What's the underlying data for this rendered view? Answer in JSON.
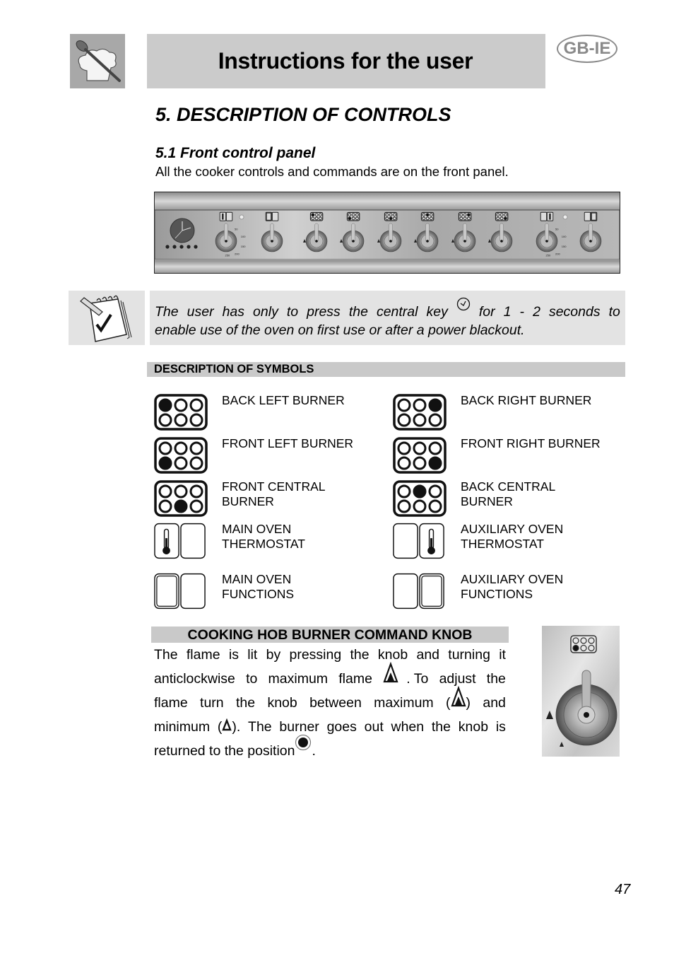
{
  "header": {
    "title": "Instructions for the user",
    "language_badge": "GB-IE",
    "logo_icon": "chef-hat-spoon-icon"
  },
  "section": {
    "title": "5.  DESCRIPTION OF CONTROLS",
    "subsection_title": "5.1 Front control panel",
    "intro": "All the cooker controls and commands are on the front panel."
  },
  "control_panel": {
    "image": "front-control-panel-illustration",
    "clock": "analog-clock-programmer",
    "clock_buttons": 5,
    "knobs": [
      {
        "name": "main-oven-thermostat-knob",
        "symbol": "main-oven-thermostat",
        "scale": [
          "50",
          "100",
          "150",
          "200",
          "250"
        ]
      },
      {
        "name": "main-oven-functions-knob",
        "symbol": "main-oven-functions"
      },
      {
        "name": "back-left-burner-knob",
        "symbol": "burner-back-left"
      },
      {
        "name": "front-left-burner-knob",
        "symbol": "burner-front-left"
      },
      {
        "name": "front-central-burner-knob",
        "symbol": "burner-front-central"
      },
      {
        "name": "back-central-burner-knob",
        "symbol": "burner-back-central"
      },
      {
        "name": "back-right-burner-knob",
        "symbol": "burner-back-right"
      },
      {
        "name": "front-right-burner-knob",
        "symbol": "burner-front-right"
      },
      {
        "name": "auxiliary-oven-thermostat-knob",
        "symbol": "aux-oven-thermostat",
        "scale": [
          "50",
          "100",
          "150",
          "200",
          "250"
        ]
      },
      {
        "name": "auxiliary-oven-functions-knob",
        "symbol": "aux-oven-functions"
      }
    ]
  },
  "note": {
    "icon": "notepad-check-icon",
    "line1_words": [
      "The",
      "user",
      "has",
      "only",
      "to",
      "press",
      "the",
      "central",
      "key",
      "[clock]",
      "for",
      "1",
      "-",
      "2",
      "seconds",
      "to"
    ],
    "line2": "enable use of the oven on first use or after a power blackout.",
    "key_icon": "clock-key-icon"
  },
  "symbols": {
    "header": "DESCRIPTION OF SYMBOLS",
    "items": [
      {
        "label": "BACK LEFT BURNER",
        "type": "burner",
        "filled": 0
      },
      {
        "label": "BACK RIGHT BURNER",
        "type": "burner",
        "filled": 2
      },
      {
        "label": "FRONT LEFT BURNER",
        "type": "burner",
        "filled": 3
      },
      {
        "label": "FRONT RIGHT BURNER",
        "type": "burner",
        "filled": 5
      },
      {
        "label": "FRONT CENTRAL BURNER",
        "line1": "FRONT CENTRAL",
        "line2": "BURNER",
        "type": "burner",
        "filled": 4
      },
      {
        "label": "BACK CENTRAL BURNER",
        "line1": "BACK CENTRAL",
        "line2": "BURNER",
        "type": "burner",
        "filled": 1
      },
      {
        "label": "MAIN OVEN THERMOSTAT",
        "line1": "MAIN OVEN",
        "line2": "THERMOSTAT",
        "type": "thermostat",
        "side": "left"
      },
      {
        "label": "AUXILIARY OVEN THERMOSTAT",
        "line1": "AUXILIARY OVEN",
        "line2": "THERMOSTAT",
        "type": "thermostat",
        "side": "right"
      },
      {
        "label": "MAIN OVEN FUNCTIONS",
        "line1": "MAIN OVEN",
        "line2": "FUNCTIONS",
        "type": "functions",
        "side": "left"
      },
      {
        "label": "AUXILIARY OVEN FUNCTIONS",
        "line1": "AUXILIARY OVEN",
        "line2": "FUNCTIONS",
        "type": "functions",
        "side": "right"
      }
    ]
  },
  "knob_section": {
    "header": "COOKING HOB BURNER COMMAND KNOB",
    "lines": [
      [
        "The",
        "flame",
        "is",
        "lit",
        "by",
        "pressing",
        "the",
        "knob",
        "and",
        "turning",
        "it"
      ],
      [
        "anticlockwise",
        "to",
        "maximum",
        "flame",
        "[max]",
        ". To",
        "adjust",
        "the"
      ],
      [
        "flame",
        "turn",
        "the",
        "knob",
        "between",
        "maximum",
        "([max])",
        "and"
      ],
      [
        "minimum",
        "([min]).",
        "The",
        "burner",
        "goes",
        "out",
        "when",
        "the",
        "knob",
        "is"
      ],
      [
        "returned to the position",
        "[off]",
        "."
      ]
    ],
    "icons": {
      "max": "max-flame-icon",
      "min": "min-flame-icon",
      "off": "off-position-icon"
    },
    "image": "burner-knob-illustration",
    "image_symbol": "burner-front-left"
  },
  "page_number": "47"
}
